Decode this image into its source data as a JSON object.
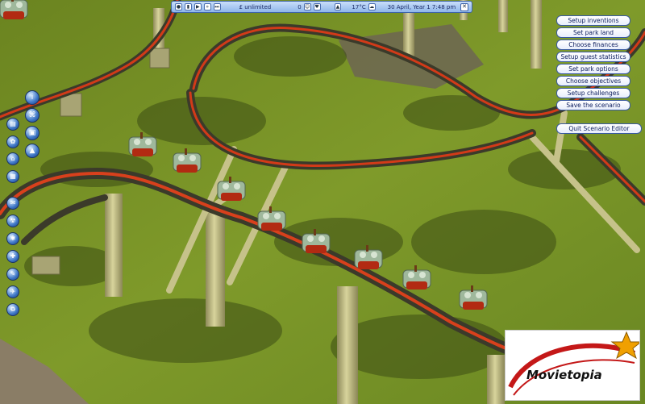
{
  "statusbar": {
    "money": "£ unlimited",
    "guests": "0",
    "temperature": "17°C",
    "date": "30 April, Year 1  7:48 pm",
    "speed_controls": [
      "pause",
      "play",
      "fast",
      "faster"
    ]
  },
  "menu": {
    "setup_inventions": "Setup inventions",
    "set_park_land": "Set park land",
    "choose_finances": "Choose finances",
    "setup_guest_statistics": "Setup guest statistics",
    "set_park_options": "Set park options",
    "choose_objectives": "Choose objectives",
    "setup_challenges": "Setup challenges",
    "save_scenario": "Save the scenario",
    "quit_editor": "Quit Scenario Editor"
  },
  "toolbar_icons": [
    "info-icon",
    "landscape-icon",
    "path-icon",
    "save-icon",
    "rides-icon",
    "scenery-icon",
    "shops-icon",
    "staff-icon",
    "finance-icon",
    "research-icon",
    "settings-icon",
    "camera-icon",
    "zoom-icon",
    "trash-icon"
  ],
  "watermark": {
    "text": "Movietopia"
  },
  "colors": {
    "grass": "#5a7a1e",
    "track_rail": "#d23a18",
    "support": "#c8c48a",
    "ui_blue": "#3a5aa0"
  }
}
